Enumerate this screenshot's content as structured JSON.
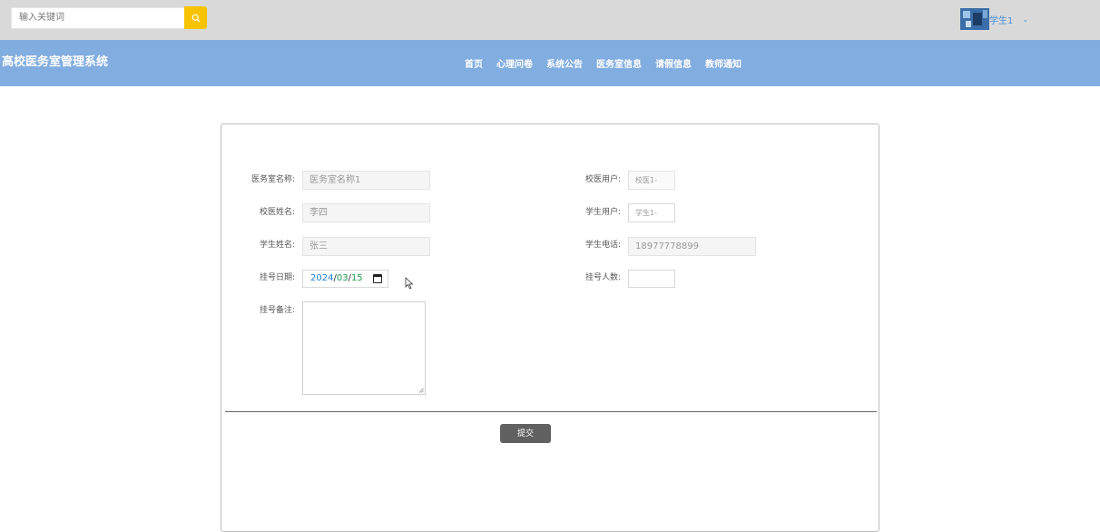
{
  "header": {
    "search_placeholder": "输入关键词",
    "username": "学生1"
  },
  "nav": {
    "site_title": "高校医务室管理系统",
    "items": [
      "首页",
      "心理问卷",
      "系统公告",
      "医务室信息",
      "请假信息",
      "教师通知"
    ]
  },
  "form": {
    "clinic_name": {
      "label": "医务室名称:",
      "value": "医务室名称1"
    },
    "doctor_user": {
      "label": "校医用户:",
      "value": "校医1-"
    },
    "doctor_name": {
      "label": "校医姓名:",
      "value": "李四"
    },
    "student_user": {
      "label": "学生用户:",
      "value": "学生1-"
    },
    "student_name": {
      "label": "学生姓名:",
      "value": "张三"
    },
    "student_phone": {
      "label": "学生电话:",
      "value": "18977778899"
    },
    "reg_date": {
      "label": "挂号日期:",
      "year": "2024",
      "month": "03",
      "day": "15"
    },
    "reg_count": {
      "label": "挂号人数:",
      "value": ""
    },
    "reg_note": {
      "label": "挂号备注:",
      "value": ""
    },
    "submit_label": "提交"
  },
  "colors": {
    "topbar": "#d9d9d9",
    "navbar": "#82ade0",
    "search_button": "#f7c300",
    "submit_button": "#616161"
  }
}
